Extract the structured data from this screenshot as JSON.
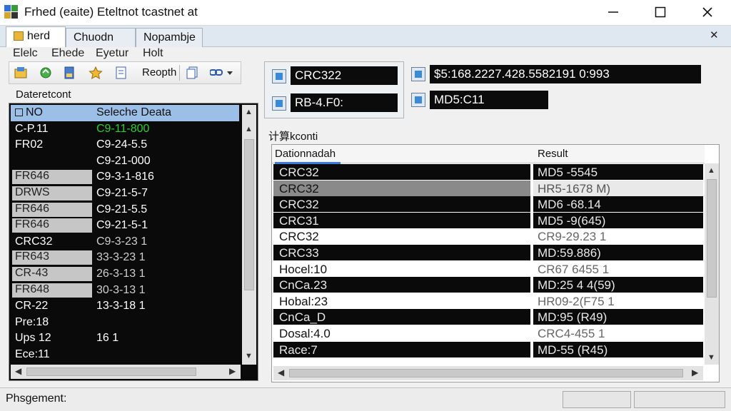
{
  "window": {
    "title": "Frhed (eaite) Eteltnot tcastnet at"
  },
  "tabs": [
    {
      "label": "herd"
    },
    {
      "label": "Chuodn"
    },
    {
      "label": "Nopambje"
    }
  ],
  "menu": [
    "Elelc",
    "Ehede",
    "Eyetur",
    "Holt"
  ],
  "toolbar": {
    "label": "Reopth"
  },
  "left_panel": {
    "label": "Dateretcont",
    "header": {
      "col1": "NO",
      "col2": "Seleche Deata"
    },
    "rows": [
      {
        "name": "C-P.11",
        "value": "C9-11-800"
      },
      {
        "name": "FR02",
        "value": "C9-24-5.5"
      },
      {
        "name": "",
        "value": "C9-21-000"
      },
      {
        "name": "FR646",
        "value": "C9-3-1-816"
      },
      {
        "name": "DRWS",
        "value": "C9-21-5-7"
      },
      {
        "name": "FR646",
        "value": "C9-21-5.5"
      },
      {
        "name": "FR646",
        "value": "C9-21-5-1"
      },
      {
        "name": "CRC32",
        "value": "C9-3-23 1"
      },
      {
        "name": "FR643",
        "value": "33-3-23 1"
      },
      {
        "name": "CR-43",
        "value": "26-3-13 1"
      },
      {
        "name": "FR648",
        "value": "30-3-13 1"
      },
      {
        "name": "CR-22",
        "value": "13-3-18 1"
      },
      {
        "name": "Pre:18",
        "value": ""
      },
      {
        "name": "Ups 12",
        "value": "16 1"
      },
      {
        "name": "Ece:11",
        "value": ""
      }
    ]
  },
  "hashes": {
    "crc": "CRC322",
    "rb": "RB-4.F0:",
    "sha": "$5:168.2227.428.5582191 0:993",
    "md5": "MD5:C11"
  },
  "results": {
    "title": "计算kconti",
    "col1": "Dationnadah",
    "col2": "Result",
    "rows": [
      {
        "name": "CRC32",
        "result": "MD5 -5545"
      },
      {
        "name": "CRC32",
        "result": "HR5-1678 M)"
      },
      {
        "name": "CRC32",
        "result": "MD6 -68.14"
      },
      {
        "name": "CRC31",
        "result": "MD5 -9(645)"
      },
      {
        "name": "CRC32",
        "result": "CR9-29.23 1"
      },
      {
        "name": "CRC33",
        "result": "MD:59.886)"
      },
      {
        "name": "Hocel:10",
        "result": "CR67 6455 1"
      },
      {
        "name": "CnCa.23",
        "result": "MD:25 4 4(59)"
      },
      {
        "name": "Hobal:23",
        "result": "HR09-2(F75 1"
      },
      {
        "name": "CnCa_D",
        "result": "MD:95 (R49)"
      },
      {
        "name": "Dosal:4.0",
        "result": "CRC4-455 1"
      },
      {
        "name": "Race:7",
        "result": "MD-55 (R45)"
      }
    ]
  },
  "status": {
    "text": "Phsgement:"
  }
}
